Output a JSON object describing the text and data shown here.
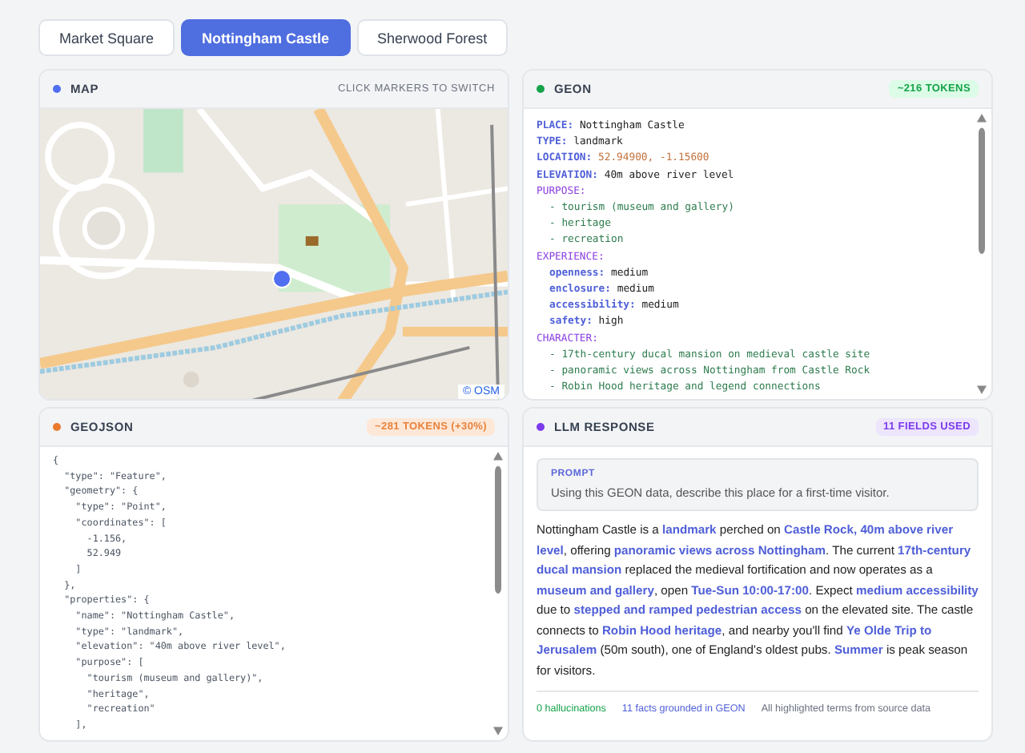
{
  "tabs": [
    {
      "label": "Market Square",
      "selected": false
    },
    {
      "label": "Nottingham Castle",
      "selected": true
    },
    {
      "label": "Sherwood Forest",
      "selected": false
    }
  ],
  "map": {
    "title": "MAP",
    "hint": "CLICK MARKERS TO SWITCH",
    "attribution": "© OSM"
  },
  "geon": {
    "title": "GEON",
    "badge": "~216 TOKENS",
    "lines": [
      {
        "kind": "field",
        "key": "PLACE:",
        "value": "Nottingham Castle"
      },
      {
        "kind": "field",
        "key": "TYPE:",
        "value": "landmark"
      },
      {
        "kind": "coord",
        "key": "LOCATION:",
        "value": "52.94900, -1.15600"
      },
      {
        "kind": "field",
        "key": "ELEVATION:",
        "value": "40m above river level"
      },
      {
        "kind": "section",
        "key": "PURPOSE:"
      },
      {
        "kind": "item",
        "value": "- tourism (museum and gallery)"
      },
      {
        "kind": "item",
        "value": "- heritage"
      },
      {
        "kind": "item",
        "value": "- recreation"
      },
      {
        "kind": "section",
        "key": "EXPERIENCE:"
      },
      {
        "kind": "attr",
        "key": "openness:",
        "value": "medium"
      },
      {
        "kind": "attr",
        "key": "enclosure:",
        "value": "medium"
      },
      {
        "kind": "attr",
        "key": "accessibility:",
        "value": "medium"
      },
      {
        "kind": "attr",
        "key": "safety:",
        "value": "high"
      },
      {
        "kind": "section",
        "key": "CHARACTER:"
      },
      {
        "kind": "item",
        "value": "- 17th-century ducal mansion on medieval castle site"
      },
      {
        "kind": "item",
        "value": "- panoramic views across Nottingham from Castle Rock"
      },
      {
        "kind": "item",
        "value": "- Robin Hood heritage and legend connections"
      }
    ]
  },
  "geojson": {
    "title": "GEOJSON",
    "badge": "~281 TOKENS (+30%)",
    "lines": [
      "{",
      "  \"type\": \"Feature\",",
      "  \"geometry\": {",
      "    \"type\": \"Point\",",
      "    \"coordinates\": [",
      "      -1.156,",
      "      52.949",
      "    ]",
      "  },",
      "  \"properties\": {",
      "    \"name\": \"Nottingham Castle\",",
      "    \"type\": \"landmark\",",
      "    \"elevation\": \"40m above river level\",",
      "    \"purpose\": [",
      "      \"tourism (museum and gallery)\",",
      "      \"heritage\",",
      "      \"recreation\"",
      "    ],"
    ]
  },
  "llm_response": {
    "title": "LLM RESPONSE",
    "badge": "11 FIELDS USED",
    "prompt": {
      "label": "PROMPT",
      "text": "Using this GEON data, describe this place for a first-time visitor."
    },
    "response": "Nottingham Castle is a **landmark** perched on **Castle Rock, 40m above river level**, offering **panoramic views across Nottingham**. The current **17th-century ducal mansion** replaced the medieval fortification and now operates as a **museum and gallery**, open **Tue-Sun 10:00-17:00**. Expect **medium accessibility** due to **stepped and ramped pedestrian access** on the elevated site. The castle connects to **Robin Hood heritage**, and nearby you'll find **Ye Olde Trip to Jerusalem** (50m south), one of England's oldest pubs. **Summer** is peak season for visitors.",
    "footer": [
      {
        "kind": "good",
        "text": "0 hallucinations"
      },
      {
        "kind": "info",
        "text": "11 facts grounded in GEON"
      },
      {
        "kind": "note",
        "text": "All highlighted terms from source data"
      }
    ]
  }
}
